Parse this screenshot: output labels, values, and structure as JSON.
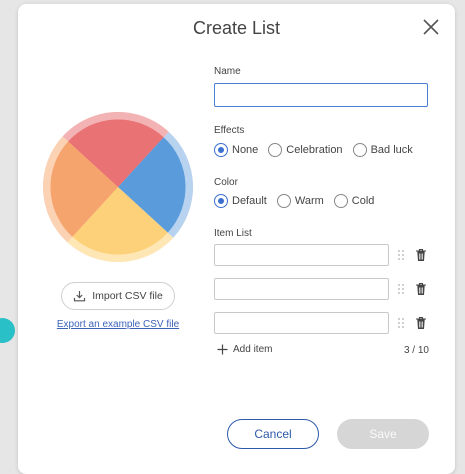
{
  "dialog": {
    "title": "Create List",
    "import_label": "Import CSV file",
    "export_link": "Export an example CSV file",
    "name": {
      "label": "Name",
      "value": "",
      "placeholder": ""
    },
    "effects": {
      "label": "Effects",
      "options": [
        "None",
        "Celebration",
        "Bad luck"
      ],
      "selected": "None"
    },
    "color": {
      "label": "Color",
      "options": [
        "Default",
        "Warm",
        "Cold"
      ],
      "selected": "Default"
    },
    "item_list": {
      "label": "Item List",
      "items": [
        "",
        "",
        ""
      ],
      "add_label": "Add item",
      "count": "3 / 10"
    },
    "cancel_label": "Cancel",
    "save_label": "Save"
  },
  "colors": {
    "accent": "#3b6fd0",
    "wheel_red": "#e87274",
    "wheel_blue": "#5a9bdb",
    "wheel_yellow": "#fdd07a",
    "wheel_orange": "#f6a46e",
    "side_dot": "#29c0c7"
  }
}
